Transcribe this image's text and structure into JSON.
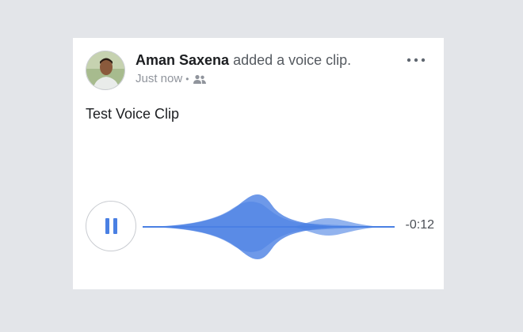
{
  "post": {
    "author": "Aman Saxena",
    "action": "added a voice clip.",
    "timestamp": "Just now",
    "separator": "•",
    "audience_icon": "friends-icon",
    "more_icon": "more-dots-icon",
    "text": "Test Voice Clip"
  },
  "player": {
    "state_icon": "pause-icon",
    "remaining": "-0:12",
    "accent": "#4a80e3"
  }
}
